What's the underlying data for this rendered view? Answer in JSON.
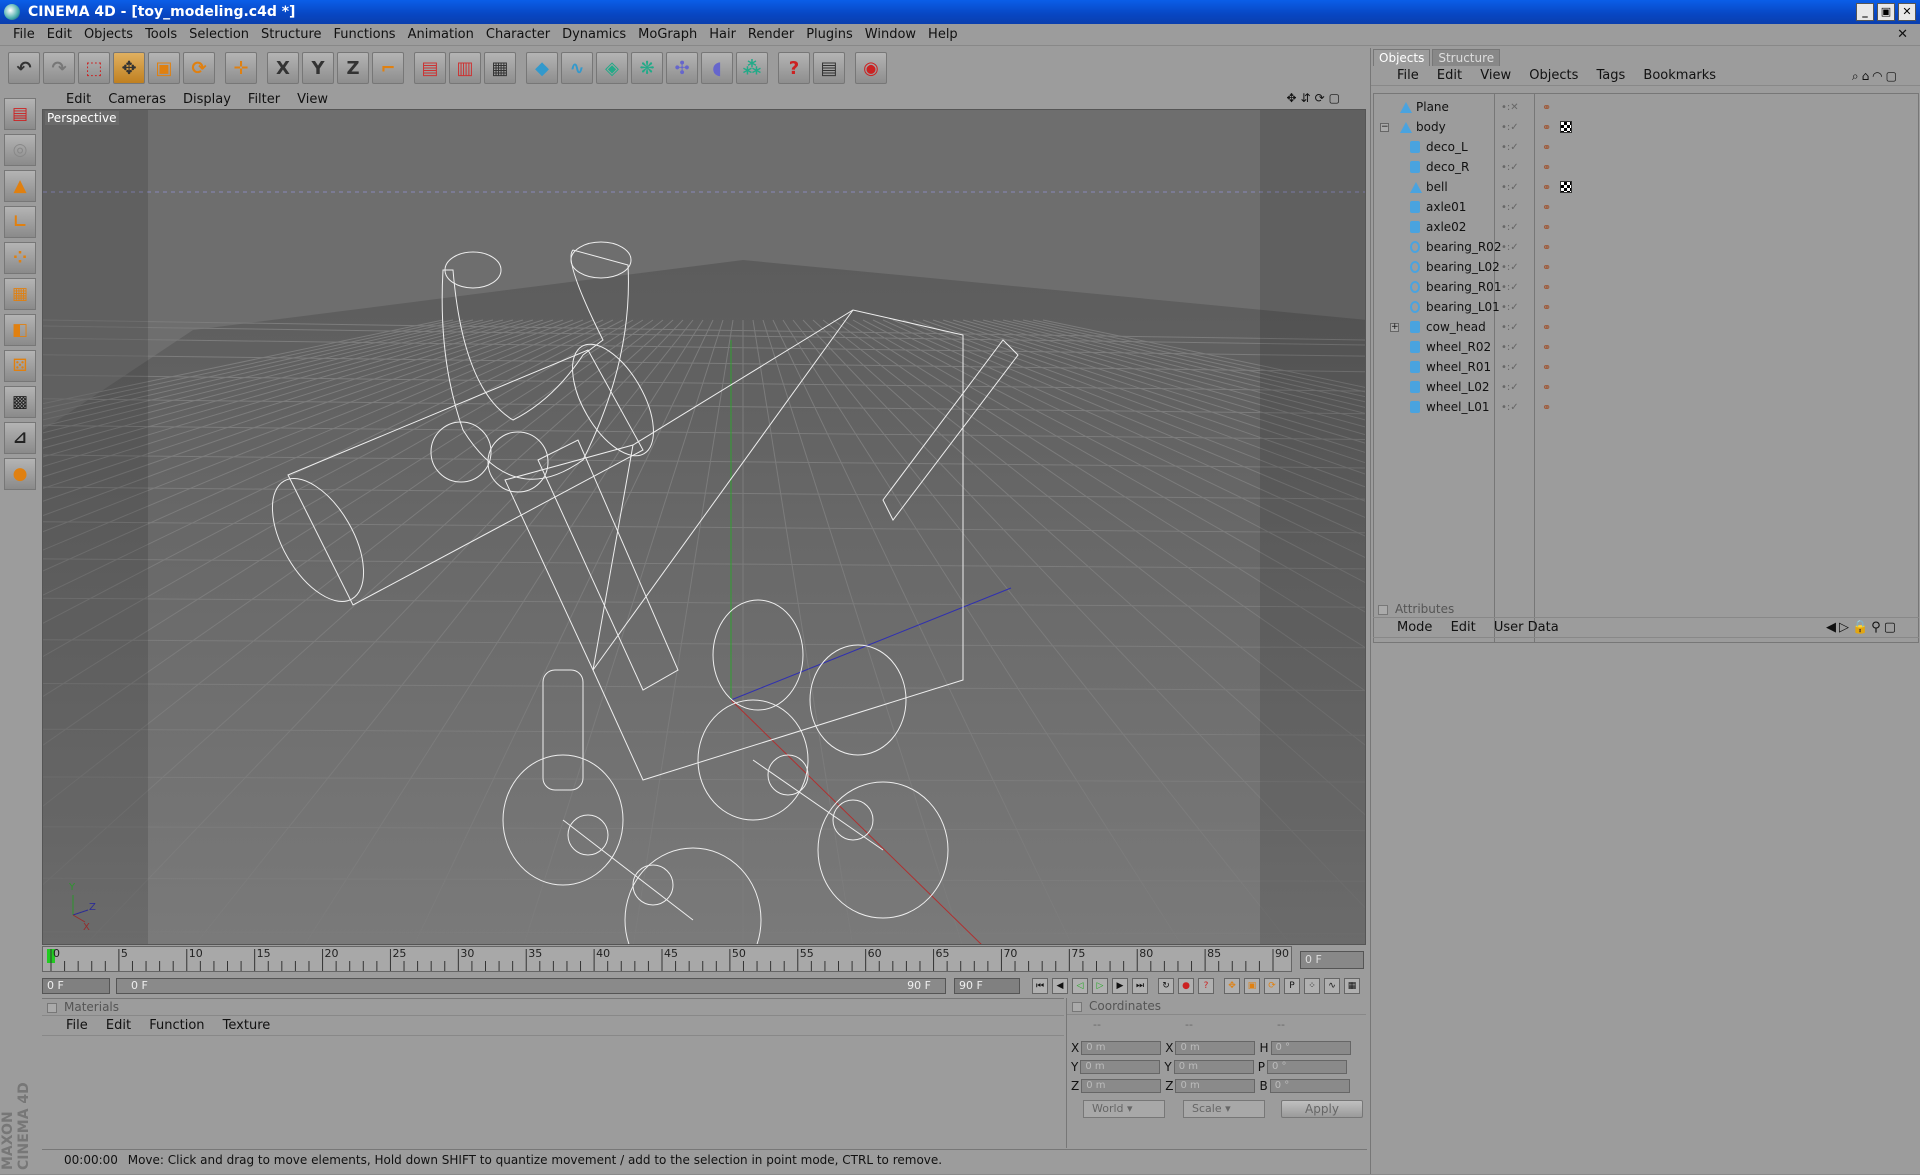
{
  "window": {
    "title": "CINEMA 4D - [toy_modeling.c4d *]",
    "controls": [
      "_",
      "▣",
      "✕"
    ]
  },
  "menubar": [
    "File",
    "Edit",
    "Objects",
    "Tools",
    "Selection",
    "Structure",
    "Functions",
    "Animation",
    "Character",
    "Dynamics",
    "MoGraph",
    "Hair",
    "Render",
    "Plugins",
    "Window",
    "Help"
  ],
  "toolbar": {
    "icons": [
      "undo-icon",
      "redo-icon",
      "live-selection-icon",
      "move-icon",
      "scale-icon",
      "rotate-icon",
      "add-object-icon",
      "x-axis-lock-icon",
      "y-axis-lock-icon",
      "z-axis-lock-icon",
      "coordinate-system-icon",
      "render-view-icon",
      "render-picture-icon",
      "render-settings-icon",
      "cube-primitive-icon",
      "spline-icon",
      "nurbs-icon",
      "array-icon",
      "deformer-icon",
      "environment-icon",
      "particles-icon",
      "help-icon",
      "edit-render-settings-icon",
      "render-to-picture-viewer-icon"
    ],
    "axis_labels": [
      "X",
      "Y",
      "Z"
    ]
  },
  "viewport": {
    "menu": [
      "Edit",
      "Cameras",
      "Display",
      "Filter",
      "View"
    ],
    "label": "Perspective",
    "axes": {
      "x": "X",
      "y": "Y",
      "z": "Z"
    }
  },
  "timeline": {
    "ticks": [
      "0",
      "5",
      "10",
      "15",
      "20",
      "25",
      "30",
      "35",
      "40",
      "45",
      "50",
      "55",
      "60",
      "65",
      "70",
      "75",
      "80",
      "85",
      "90"
    ],
    "current_frame": "0 F",
    "start_field": "0 F",
    "range_start": "0 F",
    "range_end": "90 F",
    "end_field": "90 F"
  },
  "materials": {
    "title": "Materials",
    "menu": [
      "File",
      "Edit",
      "Function",
      "Texture"
    ]
  },
  "coordinates": {
    "title": "Coordinates",
    "headers": [
      "--",
      "--",
      "--"
    ],
    "rows": [
      {
        "a": "X",
        "av": "0 m",
        "b": "X",
        "bv": "0 m",
        "c": "H",
        "cv": "0 °"
      },
      {
        "a": "Y",
        "av": "0 m",
        "b": "Y",
        "bv": "0 m",
        "c": "P",
        "cv": "0 °"
      },
      {
        "a": "Z",
        "av": "0 m",
        "b": "Z",
        "bv": "0 m",
        "c": "B",
        "cv": "0 °"
      }
    ],
    "mode": "World",
    "transform": "Scale",
    "apply": "Apply"
  },
  "status": {
    "time": "00:00:00",
    "message": "Move: Click and drag to move elements, Hold down SHIFT to quantize movement / add to the selection in point mode, CTRL to remove."
  },
  "objects_panel": {
    "tabs": [
      "Objects",
      "Structure"
    ],
    "menu": [
      "File",
      "Edit",
      "View",
      "Objects",
      "Tags",
      "Bookmarks"
    ],
    "items": [
      {
        "name": "Plane",
        "type": "plane"
      },
      {
        "name": "body",
        "type": "poly",
        "expanded": true,
        "texture": true
      },
      {
        "name": "deco_L",
        "type": "cyl"
      },
      {
        "name": "deco_R",
        "type": "cyl"
      },
      {
        "name": "bell",
        "type": "poly",
        "texture": true
      },
      {
        "name": "axle01",
        "type": "cyl"
      },
      {
        "name": "axle02",
        "type": "cyl"
      },
      {
        "name": "bearing_R02",
        "type": "torus"
      },
      {
        "name": "bearing_L02",
        "type": "torus"
      },
      {
        "name": "bearing_R01",
        "type": "torus"
      },
      {
        "name": "bearing_L01",
        "type": "torus"
      },
      {
        "name": "cow_head",
        "type": "cyl",
        "collapsed": true
      },
      {
        "name": "wheel_R02",
        "type": "cyl"
      },
      {
        "name": "wheel_R01",
        "type": "cyl"
      },
      {
        "name": "wheel_L02",
        "type": "cyl"
      },
      {
        "name": "wheel_L01",
        "type": "cyl"
      }
    ]
  },
  "attributes_panel": {
    "title": "Attributes",
    "menu": [
      "Mode",
      "Edit",
      "User Data"
    ]
  },
  "branding": "MAXON CINEMA 4D",
  "colors": {
    "title_bar": "#0846c2",
    "accent_orange": "#e08010",
    "object_icon": "#4aa3df",
    "wire": "#ffffff"
  }
}
